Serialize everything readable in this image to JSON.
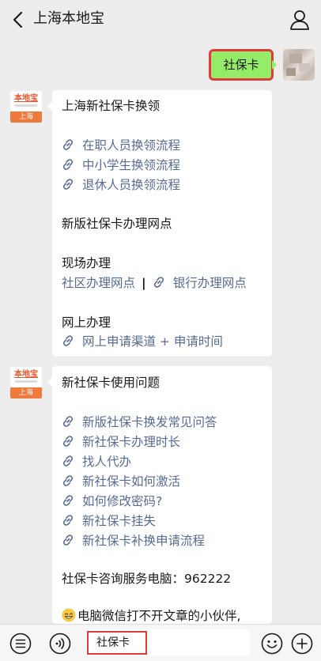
{
  "header": {
    "title": "上海本地宝"
  },
  "my_message": {
    "text": "社保卡"
  },
  "bot_avatar": {
    "top": "本地宝",
    "bottom": "上海"
  },
  "card1": {
    "heading": "上海新社保卡换领",
    "links": [
      "在职人员换领流程",
      "中小学生换领流程",
      "退休人员换领流程"
    ],
    "section1": "新版社保卡办理网点",
    "section2": "现场办理",
    "onsite_link1": "社区办理网点",
    "onsite_sep": "|",
    "onsite_link2": "银行办理网点",
    "section3": "网上办理",
    "online_link": "网上申请渠道 + 申请时间"
  },
  "card2": {
    "heading": "新社保卡使用问题",
    "links": [
      "新版社保卡换发常见问答",
      "新社保卡办理时长",
      "找人代办",
      "新社保卡如何激活",
      "如何修改密码?",
      "新社保卡挂失",
      "新社保卡补换申请流程"
    ],
    "hotline": "社保卡咨询服务电脑：962222",
    "notice": "电脑微信打不开文章的小伙伴,"
  },
  "input": {
    "value": "社保卡"
  },
  "icons": [
    "chevron-left-icon",
    "profile-icon",
    "link-icon",
    "menu-list-icon",
    "voice-icon",
    "emoji-icon",
    "plus-icon"
  ],
  "colors": {
    "link": "#576b95",
    "bubble": "#95ec69",
    "highlight": "#e03a3a",
    "brand": "#f07a3c"
  }
}
